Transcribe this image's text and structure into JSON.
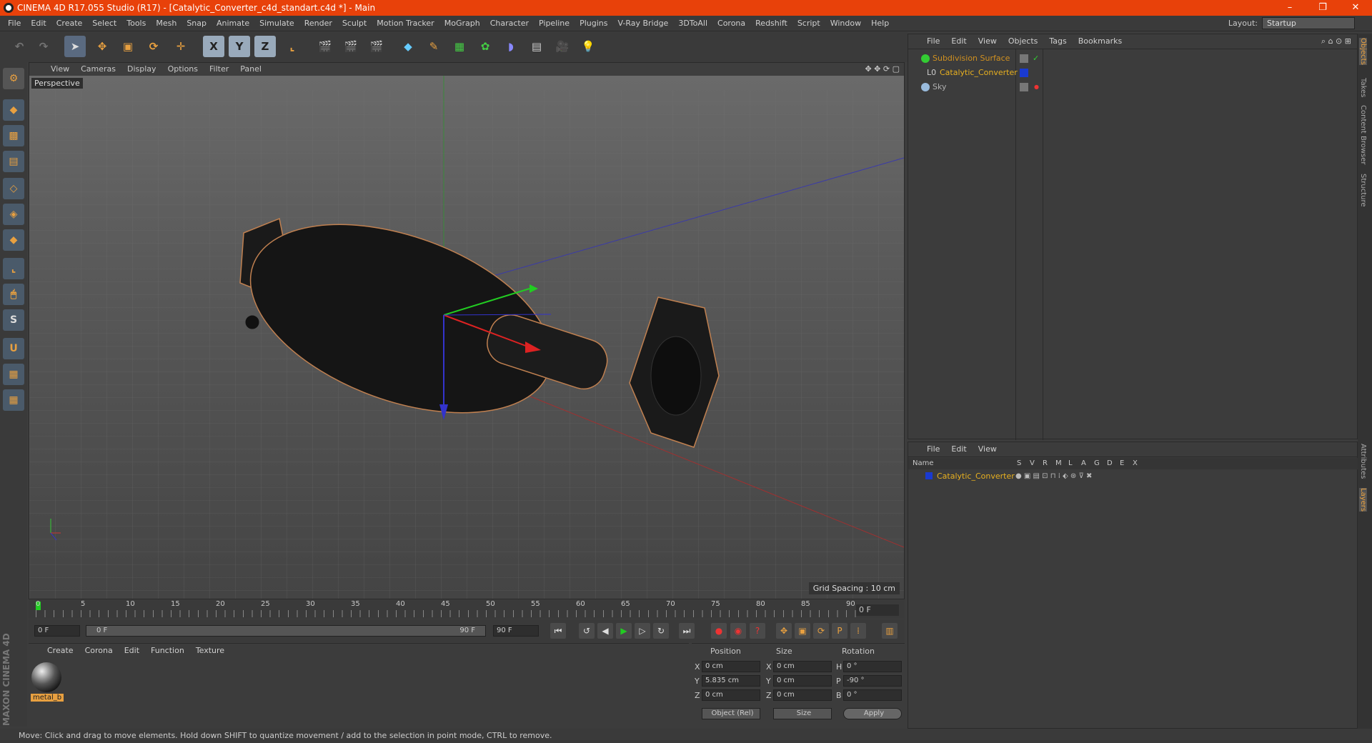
{
  "titlebar": {
    "title": "CINEMA 4D R17.055 Studio (R17) - [Catalytic_Converter_c4d_standart.c4d *] - Main",
    "minimize": "–",
    "restore": "❐",
    "close": "✕"
  },
  "menubar": {
    "items": [
      "File",
      "Edit",
      "Create",
      "Select",
      "Tools",
      "Mesh",
      "Snap",
      "Animate",
      "Simulate",
      "Render",
      "Sculpt",
      "Motion Tracker",
      "MoGraph",
      "Character",
      "Pipeline",
      "Plugins",
      "V-Ray Bridge",
      "3DToAll",
      "Corona",
      "Redshift",
      "Script",
      "Window",
      "Help"
    ],
    "layout_label": "Layout:",
    "layout_value": "Startup"
  },
  "toolbar": {
    "axis_x": "X",
    "axis_y": "Y",
    "axis_z": "Z"
  },
  "viewport": {
    "menu": [
      "View",
      "Cameras",
      "Display",
      "Options",
      "Filter",
      "Panel"
    ],
    "label": "Perspective",
    "grid_spacing": "Grid Spacing : 10 cm"
  },
  "timeline": {
    "ticks": [
      "0",
      "5",
      "10",
      "15",
      "20",
      "25",
      "30",
      "35",
      "40",
      "45",
      "50",
      "55",
      "60",
      "65",
      "70",
      "75",
      "80",
      "85",
      "90"
    ],
    "current_frame": "0 F"
  },
  "transport": {
    "start_frame": "0 F",
    "range_start": "0 F",
    "range_end": "90 F",
    "end_frame": "90 F"
  },
  "material_panel": {
    "menu": [
      "Create",
      "Corona",
      "Edit",
      "Function",
      "Texture"
    ],
    "material_name": "metal_b"
  },
  "coordinates": {
    "headers": [
      "Position",
      "Size",
      "Rotation"
    ],
    "rows": [
      {
        "pos_axis": "X",
        "pos": "0 cm",
        "size_axis": "X",
        "size": "0 cm",
        "rot_axis": "H",
        "rot": "0 °"
      },
      {
        "pos_axis": "Y",
        "pos": "5.835 cm",
        "size_axis": "Y",
        "size": "0 cm",
        "rot_axis": "P",
        "rot": "-90 °"
      },
      {
        "pos_axis": "Z",
        "pos": "0 cm",
        "size_axis": "Z",
        "size": "0 cm",
        "rot_axis": "B",
        "rot": "0 °"
      }
    ],
    "mode": "Object (Rel)",
    "size_mode": "Size",
    "apply": "Apply"
  },
  "object_manager": {
    "menu": [
      "File",
      "Edit",
      "View",
      "Objects",
      "Tags",
      "Bookmarks"
    ],
    "objects": [
      {
        "name": "Subdivision Surface",
        "color": "#d09020"
      },
      {
        "name": "Catalytic_Converter",
        "color": "#e8b020"
      },
      {
        "name": "Sky",
        "color": "#b0b0b0"
      }
    ]
  },
  "attribute_manager": {
    "menu": [
      "File",
      "Edit",
      "View"
    ],
    "columns": [
      "Name",
      "S",
      "V",
      "R",
      "M",
      "L",
      "A",
      "G",
      "D",
      "E",
      "X"
    ],
    "layer_name": "Catalytic_Converter"
  },
  "right_tabs": [
    "Objects",
    "Takes",
    "Content Browser",
    "Structure",
    "Attributes",
    "Layers"
  ],
  "statusbar": {
    "text": "Move: Click and drag to move elements. Hold down SHIFT to quantize movement / add to the selection in point mode, CTRL to remove."
  },
  "maxon_logo": "MAXON CINEMA 4D",
  "colors": {
    "titlebar": "#e8410a",
    "accent_orange": "#e8a040",
    "layer_blue": "#1a3ad0"
  }
}
